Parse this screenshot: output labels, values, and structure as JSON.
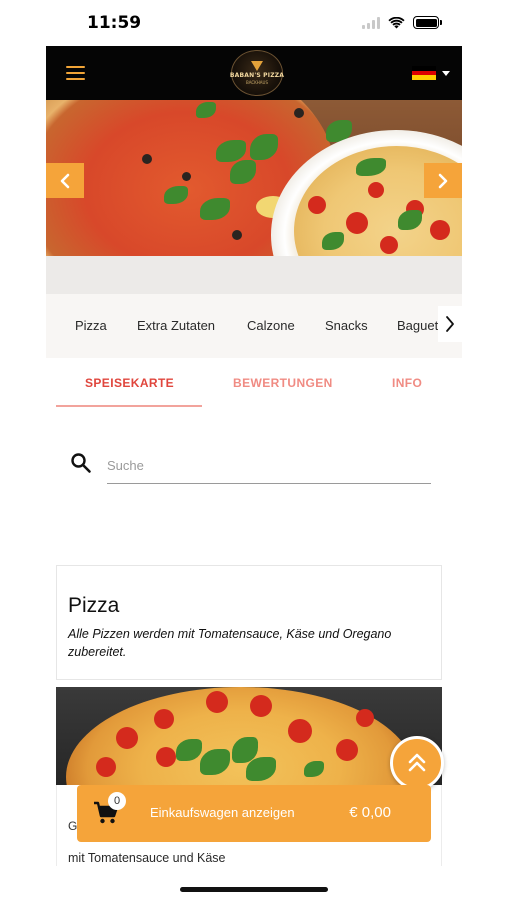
{
  "status_bar": {
    "time": "11:59"
  },
  "header": {
    "logo": {
      "name": "BABAN'S PIZZA",
      "sub": "BACKHAUS"
    },
    "language": {
      "selected": "Deutsch",
      "flag_colors": [
        "#000000",
        "#dd0000",
        "#ffce00"
      ]
    }
  },
  "hero": {
    "prev_icon": "chevron-left-icon",
    "next_icon": "chevron-right-icon"
  },
  "categories": {
    "items": [
      "Pizza",
      "Extra Zutaten",
      "Calzone",
      "Snacks",
      "Baguet"
    ],
    "next_icon": "chevron-right-icon"
  },
  "tabs": {
    "items": [
      {
        "label": "SPEISEKARTE",
        "active": true
      },
      {
        "label": "BEWERTUNGEN",
        "active": false
      },
      {
        "label": "INFO",
        "active": false
      }
    ]
  },
  "search": {
    "placeholder": "Suche",
    "value": ""
  },
  "menu_section": {
    "title": "Pizza",
    "description": "Alle Pizzen werden mit Tomatensauce, Käse und Oregano zubereitet."
  },
  "menu_item": {
    "name_fragment": "G",
    "description": "mit Tomatensauce und Käse"
  },
  "cart": {
    "count": "0",
    "label": "Einkaufswagen anzeigen",
    "total": "€ 0,00"
  },
  "colors": {
    "accent": "#f5a43a",
    "tab_active": "#e0463d",
    "tab_inactive": "#f08b83",
    "header_bg": "#050505"
  }
}
